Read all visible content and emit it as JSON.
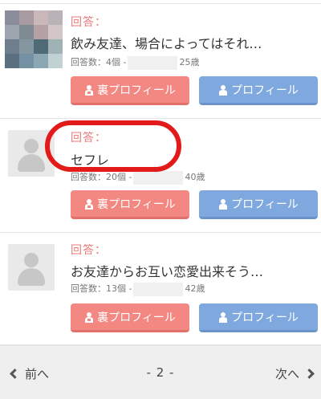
{
  "posts": [
    {
      "answer_label": "回答：",
      "answer_text": "飲み友達、場合によってはそれ…",
      "meta_prefix": "回答数：4個 -",
      "meta_suffix": "25歳",
      "ura_button": "裏プロフィール",
      "profile_button": "プロフィール"
    },
    {
      "answer_label": "回答：",
      "answer_text": "セフレ",
      "meta_prefix": "回答数：20個 -",
      "meta_suffix": "40歳",
      "ura_button": "裏プロフィール",
      "profile_button": "プロフィール"
    },
    {
      "answer_label": "回答：",
      "answer_text": "お友達からお互い恋愛出来そう…",
      "meta_prefix": "回答数：13個 -",
      "meta_suffix": "42歳",
      "ura_button": "裏プロフィール",
      "profile_button": "プロフィール"
    }
  ],
  "pager": {
    "prev": "前へ",
    "page": "- 2 -",
    "next": "次へ"
  },
  "colors": {
    "accent_red": "#f38883",
    "accent_blue": "#7fa8de",
    "label_red": "#ee7a7a",
    "highlight": "#e21a1a"
  },
  "icons": {
    "ura_button": "lock-person-icon",
    "profile_button": "person-icon",
    "prev": "chevron-left-icon",
    "next": "chevron-right-icon"
  }
}
